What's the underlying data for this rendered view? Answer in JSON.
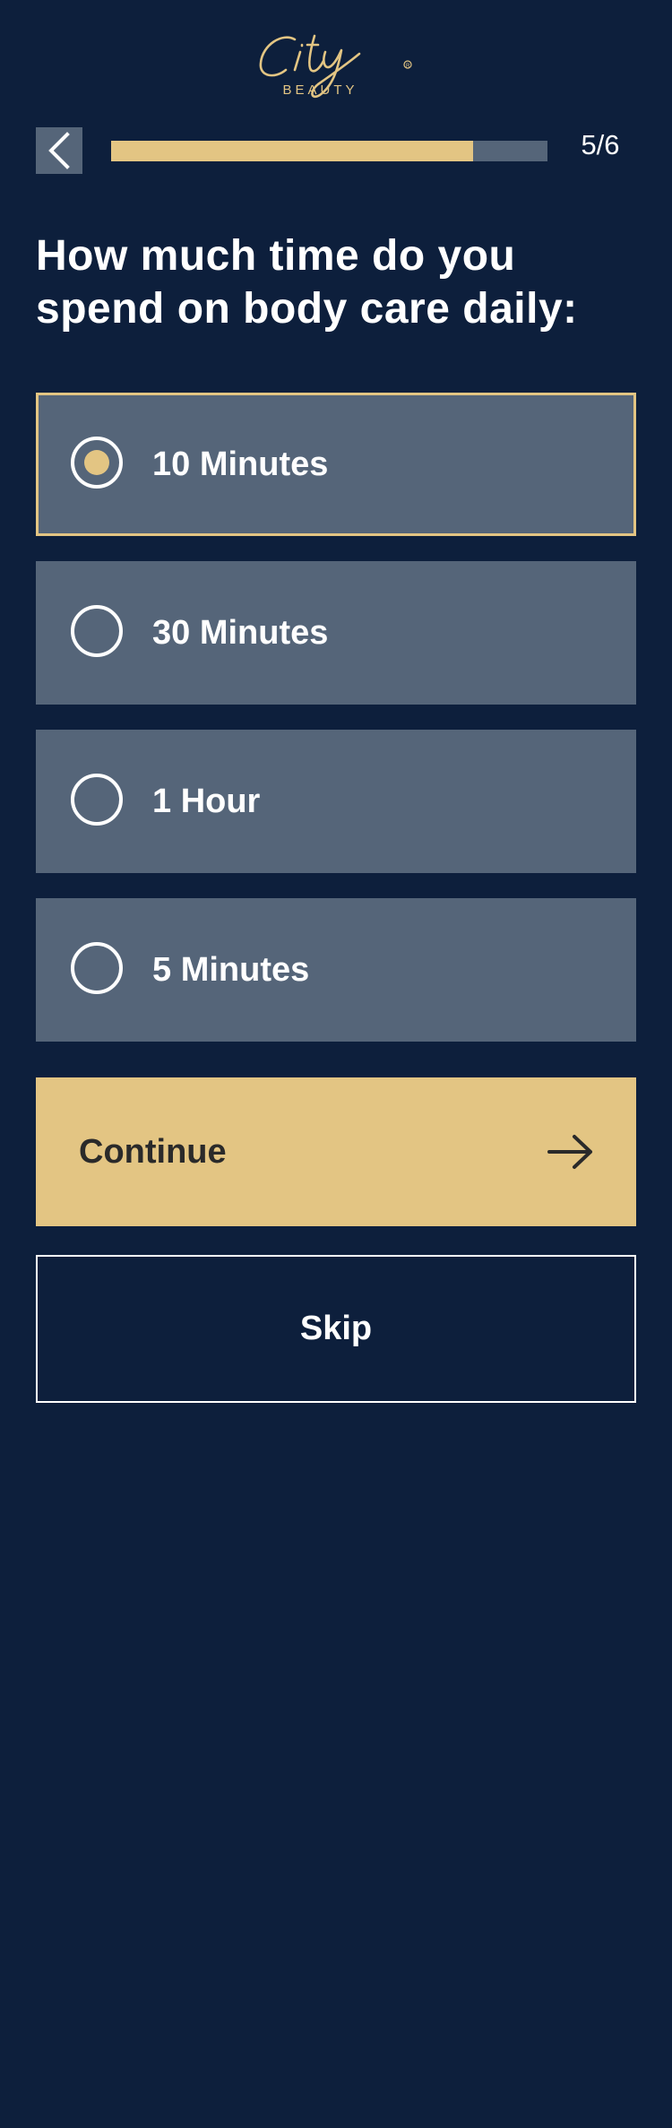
{
  "brand": {
    "name": "City",
    "subtitle": "BEAUTY",
    "accent_color": "#e3c583",
    "background_color": "#0d1f3c",
    "card_color": "#556579"
  },
  "header": {
    "back_icon": "chevron-left-icon",
    "progress": 0.83,
    "step_counter": "5/6"
  },
  "question": "How much time do you spend on body care daily:",
  "options": [
    {
      "label": "10 Minutes",
      "selected": true
    },
    {
      "label": "30 Minutes",
      "selected": false
    },
    {
      "label": "1 Hour",
      "selected": false
    },
    {
      "label": "5 Minutes",
      "selected": false
    }
  ],
  "actions": {
    "continue_label": "Continue",
    "continue_icon": "arrow-right-icon",
    "skip_label": "Skip"
  }
}
